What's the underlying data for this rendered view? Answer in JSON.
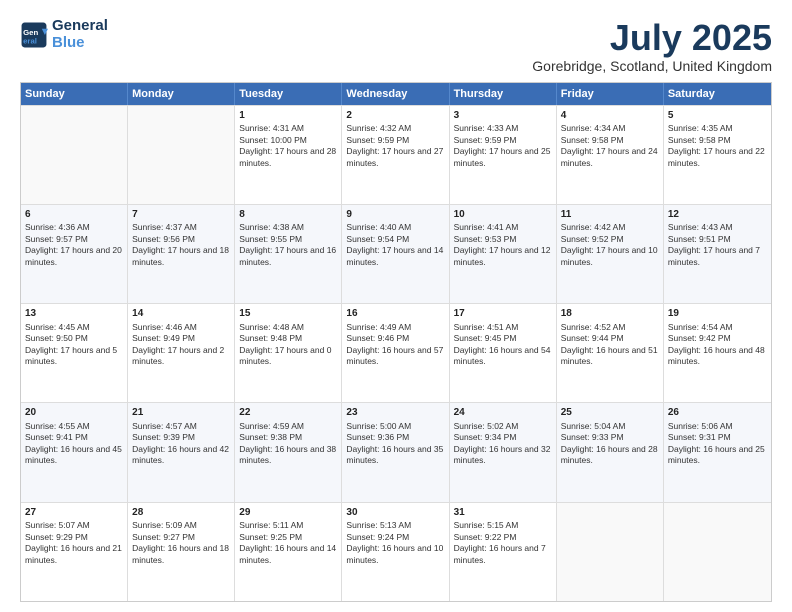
{
  "logo": {
    "line1": "General",
    "line2": "Blue"
  },
  "title": "July 2025",
  "subtitle": "Gorebridge, Scotland, United Kingdom",
  "days_of_week": [
    "Sunday",
    "Monday",
    "Tuesday",
    "Wednesday",
    "Thursday",
    "Friday",
    "Saturday"
  ],
  "weeks": [
    [
      {
        "day": "",
        "sunrise": "",
        "sunset": "",
        "daylight": ""
      },
      {
        "day": "",
        "sunrise": "",
        "sunset": "",
        "daylight": ""
      },
      {
        "day": "1",
        "sunrise": "Sunrise: 4:31 AM",
        "sunset": "Sunset: 10:00 PM",
        "daylight": "Daylight: 17 hours and 28 minutes."
      },
      {
        "day": "2",
        "sunrise": "Sunrise: 4:32 AM",
        "sunset": "Sunset: 9:59 PM",
        "daylight": "Daylight: 17 hours and 27 minutes."
      },
      {
        "day": "3",
        "sunrise": "Sunrise: 4:33 AM",
        "sunset": "Sunset: 9:59 PM",
        "daylight": "Daylight: 17 hours and 25 minutes."
      },
      {
        "day": "4",
        "sunrise": "Sunrise: 4:34 AM",
        "sunset": "Sunset: 9:58 PM",
        "daylight": "Daylight: 17 hours and 24 minutes."
      },
      {
        "day": "5",
        "sunrise": "Sunrise: 4:35 AM",
        "sunset": "Sunset: 9:58 PM",
        "daylight": "Daylight: 17 hours and 22 minutes."
      }
    ],
    [
      {
        "day": "6",
        "sunrise": "Sunrise: 4:36 AM",
        "sunset": "Sunset: 9:57 PM",
        "daylight": "Daylight: 17 hours and 20 minutes."
      },
      {
        "day": "7",
        "sunrise": "Sunrise: 4:37 AM",
        "sunset": "Sunset: 9:56 PM",
        "daylight": "Daylight: 17 hours and 18 minutes."
      },
      {
        "day": "8",
        "sunrise": "Sunrise: 4:38 AM",
        "sunset": "Sunset: 9:55 PM",
        "daylight": "Daylight: 17 hours and 16 minutes."
      },
      {
        "day": "9",
        "sunrise": "Sunrise: 4:40 AM",
        "sunset": "Sunset: 9:54 PM",
        "daylight": "Daylight: 17 hours and 14 minutes."
      },
      {
        "day": "10",
        "sunrise": "Sunrise: 4:41 AM",
        "sunset": "Sunset: 9:53 PM",
        "daylight": "Daylight: 17 hours and 12 minutes."
      },
      {
        "day": "11",
        "sunrise": "Sunrise: 4:42 AM",
        "sunset": "Sunset: 9:52 PM",
        "daylight": "Daylight: 17 hours and 10 minutes."
      },
      {
        "day": "12",
        "sunrise": "Sunrise: 4:43 AM",
        "sunset": "Sunset: 9:51 PM",
        "daylight": "Daylight: 17 hours and 7 minutes."
      }
    ],
    [
      {
        "day": "13",
        "sunrise": "Sunrise: 4:45 AM",
        "sunset": "Sunset: 9:50 PM",
        "daylight": "Daylight: 17 hours and 5 minutes."
      },
      {
        "day": "14",
        "sunrise": "Sunrise: 4:46 AM",
        "sunset": "Sunset: 9:49 PM",
        "daylight": "Daylight: 17 hours and 2 minutes."
      },
      {
        "day": "15",
        "sunrise": "Sunrise: 4:48 AM",
        "sunset": "Sunset: 9:48 PM",
        "daylight": "Daylight: 17 hours and 0 minutes."
      },
      {
        "day": "16",
        "sunrise": "Sunrise: 4:49 AM",
        "sunset": "Sunset: 9:46 PM",
        "daylight": "Daylight: 16 hours and 57 minutes."
      },
      {
        "day": "17",
        "sunrise": "Sunrise: 4:51 AM",
        "sunset": "Sunset: 9:45 PM",
        "daylight": "Daylight: 16 hours and 54 minutes."
      },
      {
        "day": "18",
        "sunrise": "Sunrise: 4:52 AM",
        "sunset": "Sunset: 9:44 PM",
        "daylight": "Daylight: 16 hours and 51 minutes."
      },
      {
        "day": "19",
        "sunrise": "Sunrise: 4:54 AM",
        "sunset": "Sunset: 9:42 PM",
        "daylight": "Daylight: 16 hours and 48 minutes."
      }
    ],
    [
      {
        "day": "20",
        "sunrise": "Sunrise: 4:55 AM",
        "sunset": "Sunset: 9:41 PM",
        "daylight": "Daylight: 16 hours and 45 minutes."
      },
      {
        "day": "21",
        "sunrise": "Sunrise: 4:57 AM",
        "sunset": "Sunset: 9:39 PM",
        "daylight": "Daylight: 16 hours and 42 minutes."
      },
      {
        "day": "22",
        "sunrise": "Sunrise: 4:59 AM",
        "sunset": "Sunset: 9:38 PM",
        "daylight": "Daylight: 16 hours and 38 minutes."
      },
      {
        "day": "23",
        "sunrise": "Sunrise: 5:00 AM",
        "sunset": "Sunset: 9:36 PM",
        "daylight": "Daylight: 16 hours and 35 minutes."
      },
      {
        "day": "24",
        "sunrise": "Sunrise: 5:02 AM",
        "sunset": "Sunset: 9:34 PM",
        "daylight": "Daylight: 16 hours and 32 minutes."
      },
      {
        "day": "25",
        "sunrise": "Sunrise: 5:04 AM",
        "sunset": "Sunset: 9:33 PM",
        "daylight": "Daylight: 16 hours and 28 minutes."
      },
      {
        "day": "26",
        "sunrise": "Sunrise: 5:06 AM",
        "sunset": "Sunset: 9:31 PM",
        "daylight": "Daylight: 16 hours and 25 minutes."
      }
    ],
    [
      {
        "day": "27",
        "sunrise": "Sunrise: 5:07 AM",
        "sunset": "Sunset: 9:29 PM",
        "daylight": "Daylight: 16 hours and 21 minutes."
      },
      {
        "day": "28",
        "sunrise": "Sunrise: 5:09 AM",
        "sunset": "Sunset: 9:27 PM",
        "daylight": "Daylight: 16 hours and 18 minutes."
      },
      {
        "day": "29",
        "sunrise": "Sunrise: 5:11 AM",
        "sunset": "Sunset: 9:25 PM",
        "daylight": "Daylight: 16 hours and 14 minutes."
      },
      {
        "day": "30",
        "sunrise": "Sunrise: 5:13 AM",
        "sunset": "Sunset: 9:24 PM",
        "daylight": "Daylight: 16 hours and 10 minutes."
      },
      {
        "day": "31",
        "sunrise": "Sunrise: 5:15 AM",
        "sunset": "Sunset: 9:22 PM",
        "daylight": "Daylight: 16 hours and 7 minutes."
      },
      {
        "day": "",
        "sunrise": "",
        "sunset": "",
        "daylight": ""
      },
      {
        "day": "",
        "sunrise": "",
        "sunset": "",
        "daylight": ""
      }
    ]
  ]
}
